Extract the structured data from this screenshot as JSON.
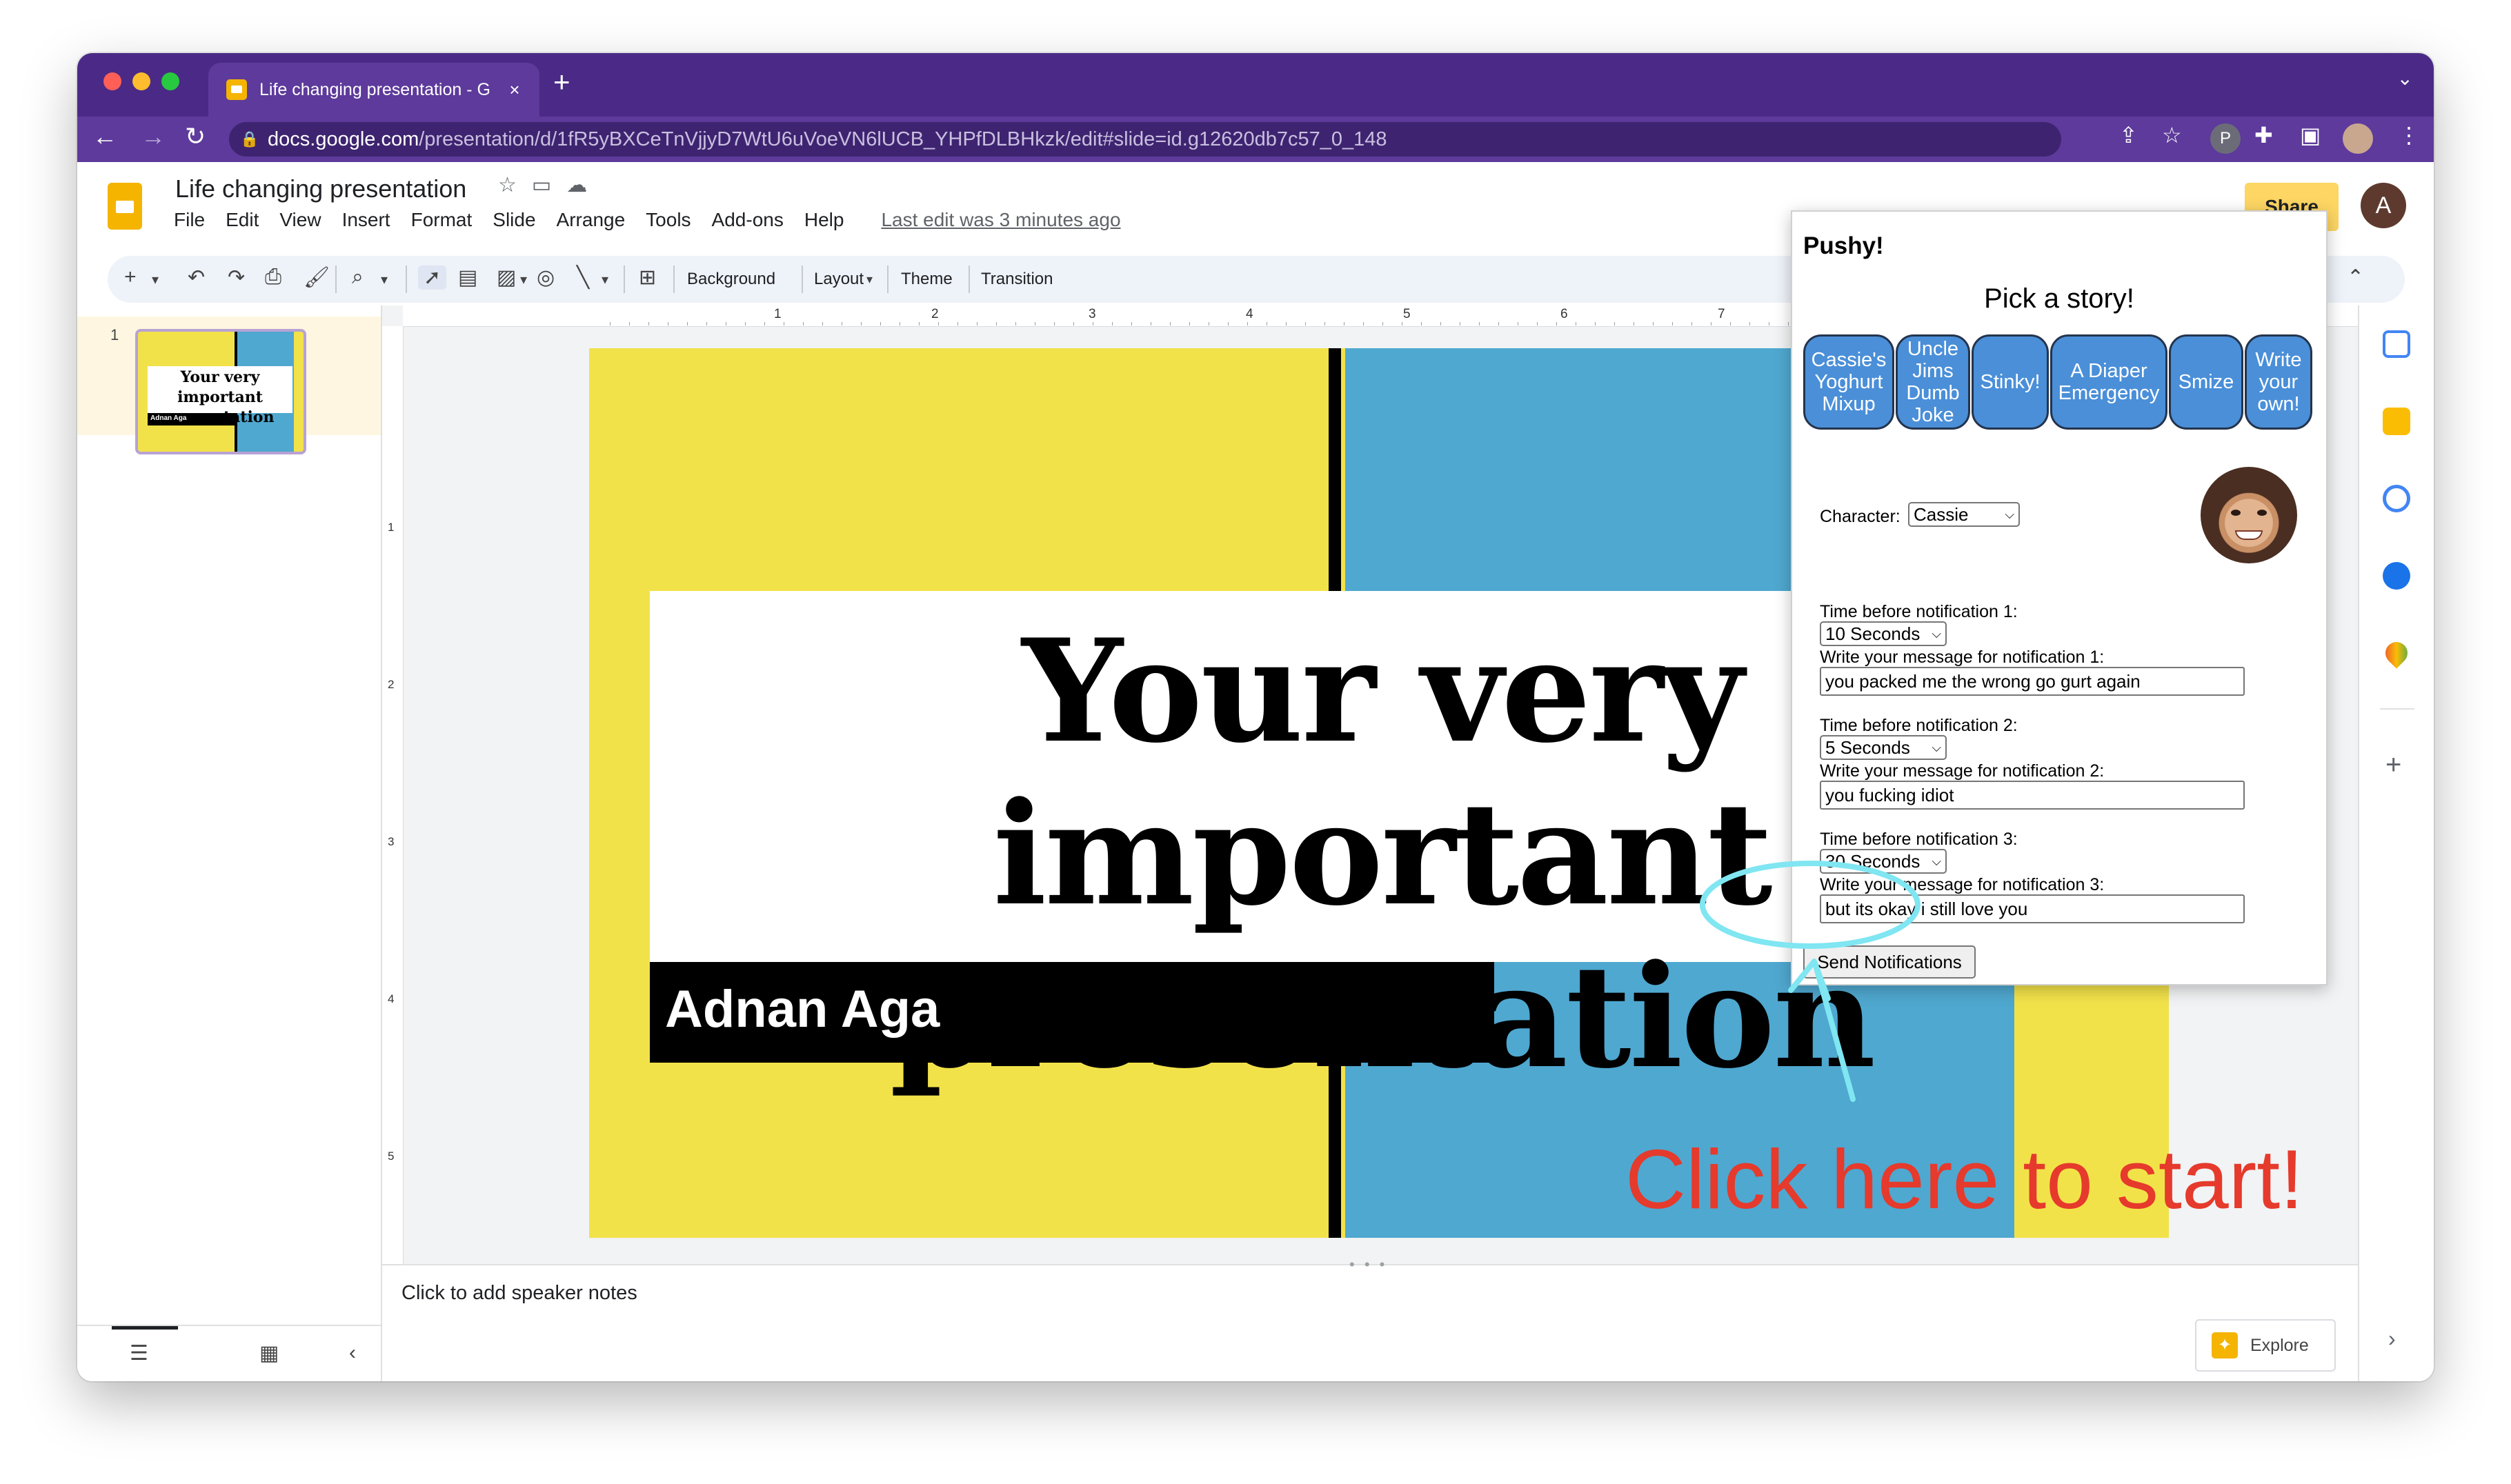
{
  "browser": {
    "tab_title": "Life changing presentation - G",
    "url_host": "docs.google.com",
    "url_path": "/presentation/d/1fR5yBXCeTnVjjyD7WtU6uVoeVN6lUCB_YHPfDLBHkzk/edit#slide=id.g12620db7c57_0_148",
    "profile_initial": "P"
  },
  "docs": {
    "title": "Life changing presentation",
    "menu": [
      "File",
      "Edit",
      "View",
      "Insert",
      "Format",
      "Slide",
      "Arrange",
      "Tools",
      "Add-ons",
      "Help"
    ],
    "last_edit": "Last edit was 3 minutes ago",
    "share_label": "Share",
    "account_initial": "A"
  },
  "toolbar": {
    "background": "Background",
    "layout": "Layout",
    "theme": "Theme",
    "transition": "Transition"
  },
  "rulers": {
    "h": [
      "1",
      "2",
      "3",
      "4",
      "5",
      "6",
      "7"
    ],
    "v": [
      "1",
      "2",
      "3",
      "4",
      "5"
    ]
  },
  "filmstrip": {
    "slide_number": "1",
    "thumb_title": "Your very important presentation",
    "thumb_name": "Adnan Aga"
  },
  "slide": {
    "title": "Your very important presentation",
    "subtitle": "Adnan Aga",
    "colors": {
      "yellow": "#f2e24a",
      "blue": "#4fa8d0",
      "black": "#000000"
    }
  },
  "notes": {
    "placeholder": "Click to add speaker notes"
  },
  "explore": {
    "label": "Explore"
  },
  "popup": {
    "title": "Pushy!",
    "pick_heading": "Pick a story!",
    "stories": [
      "Cassie's Yoghurt Mixup",
      "Uncle Jims Dumb Joke",
      "Stinky!",
      "A Diaper Emergency",
      "Smize",
      "Write your own!"
    ],
    "character_label": "Character:",
    "character_value": "Cassie",
    "notifications": [
      {
        "time_label": "Time before notification 1:",
        "time_value": "10 Seconds",
        "message_label": "Write your message for notification 1:",
        "message": "you packed me the wrong go gurt again"
      },
      {
        "time_label": "Time before notification 2:",
        "time_value": "5 Seconds",
        "message_label": "Write your message for notification 2:",
        "message": "you fucking idiot"
      },
      {
        "time_label": "Time before notification 3:",
        "time_value": "30 Seconds",
        "message_label": "Write your message for notification 3:",
        "message": "but its okay i still love you"
      }
    ],
    "send_label": "Send Notifications",
    "button_color": "#4a8fd8"
  },
  "annotation": {
    "text": "Click here to start!",
    "text_color": "#e53a2c",
    "circle_color": "#7fe6f2"
  }
}
